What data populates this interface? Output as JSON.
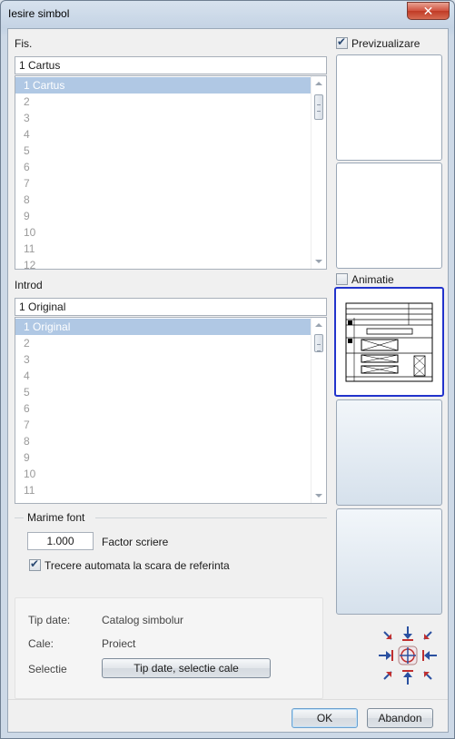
{
  "window": {
    "title": "Iesire simbol",
    "close_glyph": "✕"
  },
  "fis": {
    "label": "Fis.",
    "value": "1 Cartus",
    "items": [
      "1 Cartus",
      "2",
      "3",
      "4",
      "5",
      "6",
      "7",
      "8",
      "9",
      "10",
      "11",
      "12"
    ],
    "selected_index": 0
  },
  "introd": {
    "label": "Introd",
    "value": "1 Original",
    "items": [
      "1 Original",
      "2",
      "3",
      "4",
      "5",
      "6",
      "7",
      "8",
      "9",
      "10",
      "11"
    ],
    "selected_index": 0
  },
  "preview": {
    "label": "Previzualizare",
    "checked": true
  },
  "animation": {
    "label": "Animatie",
    "checked": false
  },
  "font": {
    "group_label": "Marime font",
    "factor_value": "1.000",
    "factor_label": "Factor scriere",
    "auto_scale_label": "Trecere automata la scara de referinta",
    "auto_scale_checked": true
  },
  "info": {
    "tip_label": "Tip date:",
    "tip_value": "Catalog simbolur",
    "cale_label": "Cale:",
    "cale_value": "Proiect",
    "selectie_label": "Selectie",
    "selectie_button": "Tip date, selectie cale"
  },
  "buttons": {
    "ok": "OK",
    "cancel": "Abandon"
  },
  "colors": {
    "selection": "#b0c8e4",
    "selected_preview_border": "#2233cc",
    "close": "#c03a25"
  }
}
